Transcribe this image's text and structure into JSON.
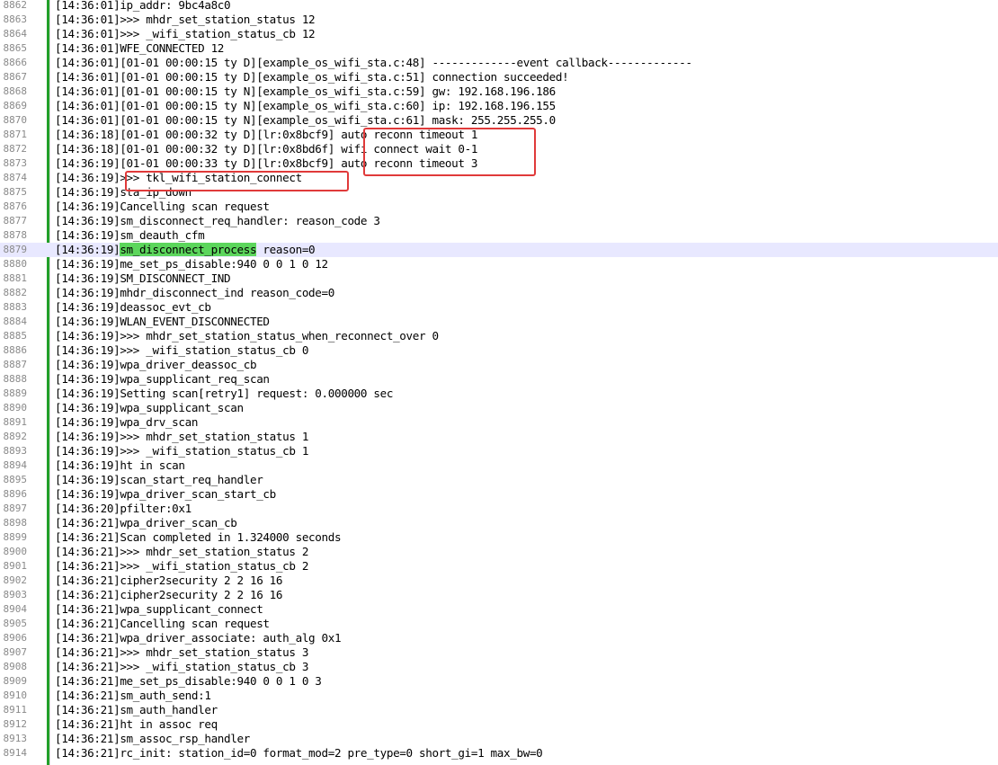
{
  "editor": {
    "lines": [
      {
        "num": "8862",
        "text": "[14:36:01]ip_addr: 9bc4a8c0"
      },
      {
        "num": "8863",
        "text": "[14:36:01]>>> mhdr_set_station_status 12"
      },
      {
        "num": "8864",
        "text": "[14:36:01]>>> _wifi_station_status_cb 12"
      },
      {
        "num": "8865",
        "text": "[14:36:01]WFE_CONNECTED 12"
      },
      {
        "num": "8866",
        "text": "[14:36:01][01-01 00:00:15 ty D][example_os_wifi_sta.c:48] -------------event callback-------------"
      },
      {
        "num": "8867",
        "text": "[14:36:01][01-01 00:00:15 ty D][example_os_wifi_sta.c:51] connection succeeded!"
      },
      {
        "num": "8868",
        "text": "[14:36:01][01-01 00:00:15 ty N][example_os_wifi_sta.c:59] gw: 192.168.196.186"
      },
      {
        "num": "8869",
        "text": "[14:36:01][01-01 00:00:15 ty N][example_os_wifi_sta.c:60] ip: 192.168.196.155"
      },
      {
        "num": "8870",
        "text": "[14:36:01][01-01 00:00:15 ty N][example_os_wifi_sta.c:61] mask: 255.255.255.0"
      },
      {
        "num": "8871",
        "text": "[14:36:18][01-01 00:00:32 ty D][lr:0x8bcf9] auto reconn timeout 1"
      },
      {
        "num": "8872",
        "text": "[14:36:18][01-01 00:00:32 ty D][lr:0x8bd6f] wifi connect wait 0-1"
      },
      {
        "num": "8873",
        "text": "[14:36:19][01-01 00:00:33 ty D][lr:0x8bcf9] auto reconn timeout 3"
      },
      {
        "num": "8874",
        "text": "[14:36:19]>>> tkl_wifi_station_connect"
      },
      {
        "num": "8875",
        "text": "[14:36:19]sta_ip_down"
      },
      {
        "num": "8876",
        "text": "[14:36:19]Cancelling scan request"
      },
      {
        "num": "8877",
        "text": "[14:36:19]sm_disconnect_req_handler: reason_code 3"
      },
      {
        "num": "8878",
        "text": "[14:36:19]sm_deauth_cfm"
      },
      {
        "num": "8879",
        "prefix": "[14:36:19]",
        "match": "sm_disconnect_process",
        "suffix": " reason=0"
      },
      {
        "num": "8880",
        "text": "[14:36:19]me_set_ps_disable:940 0 0 1 0 12"
      },
      {
        "num": "8881",
        "text": "[14:36:19]SM_DISCONNECT_IND"
      },
      {
        "num": "8882",
        "text": "[14:36:19]mhdr_disconnect_ind reason_code=0"
      },
      {
        "num": "8883",
        "text": "[14:36:19]deassoc_evt_cb"
      },
      {
        "num": "8884",
        "text": "[14:36:19]WLAN_EVENT_DISCONNECTED"
      },
      {
        "num": "8885",
        "text": "[14:36:19]>>> mhdr_set_station_status_when_reconnect_over 0"
      },
      {
        "num": "8886",
        "text": "[14:36:19]>>> _wifi_station_status_cb 0"
      },
      {
        "num": "8887",
        "text": "[14:36:19]wpa_driver_deassoc_cb"
      },
      {
        "num": "8888",
        "text": "[14:36:19]wpa_supplicant_req_scan"
      },
      {
        "num": "8889",
        "text": "[14:36:19]Setting scan[retry1] request: 0.000000 sec"
      },
      {
        "num": "8890",
        "text": "[14:36:19]wpa_supplicant_scan"
      },
      {
        "num": "8891",
        "text": "[14:36:19]wpa_drv_scan"
      },
      {
        "num": "8892",
        "text": "[14:36:19]>>> mhdr_set_station_status 1"
      },
      {
        "num": "8893",
        "text": "[14:36:19]>>> _wifi_station_status_cb 1"
      },
      {
        "num": "8894",
        "text": "[14:36:19]ht in scan"
      },
      {
        "num": "8895",
        "text": "[14:36:19]scan_start_req_handler"
      },
      {
        "num": "8896",
        "text": "[14:36:19]wpa_driver_scan_start_cb"
      },
      {
        "num": "8897",
        "text": "[14:36:20]pfilter:0x1"
      },
      {
        "num": "8898",
        "text": "[14:36:21]wpa_driver_scan_cb"
      },
      {
        "num": "8899",
        "text": "[14:36:21]Scan completed in 1.324000 seconds"
      },
      {
        "num": "8900",
        "text": "[14:36:21]>>> mhdr_set_station_status 2"
      },
      {
        "num": "8901",
        "text": "[14:36:21]>>> _wifi_station_status_cb 2"
      },
      {
        "num": "8902",
        "text": "[14:36:21]cipher2security 2 2 16 16"
      },
      {
        "num": "8903",
        "text": "[14:36:21]cipher2security 2 2 16 16"
      },
      {
        "num": "8904",
        "text": "[14:36:21]wpa_supplicant_connect"
      },
      {
        "num": "8905",
        "text": "[14:36:21]Cancelling scan request"
      },
      {
        "num": "8906",
        "text": "[14:36:21]wpa_driver_associate: auth_alg 0x1"
      },
      {
        "num": "8907",
        "text": "[14:36:21]>>> mhdr_set_station_status 3"
      },
      {
        "num": "8908",
        "text": "[14:36:21]>>> _wifi_station_status_cb 3"
      },
      {
        "num": "8909",
        "text": "[14:36:21]me_set_ps_disable:940 0 0 1 0 3"
      },
      {
        "num": "8910",
        "text": "[14:36:21]sm_auth_send:1"
      },
      {
        "num": "8911",
        "text": "[14:36:21]sm_auth_handler"
      },
      {
        "num": "8912",
        "text": "[14:36:21]ht in assoc req"
      },
      {
        "num": "8913",
        "text": "[14:36:21]sm_assoc_rsp_handler"
      },
      {
        "num": "8914",
        "text": "[14:36:21]rc_init: station_id=0 format_mod=2 pre_type=0 short_gi=1 max_bw=0"
      }
    ]
  },
  "colors": {
    "gutter_border": "#22a02a",
    "search_highlight": "#5cd65c",
    "current_line": "#e8e8ff",
    "annotation_box": "#e03a3a"
  }
}
